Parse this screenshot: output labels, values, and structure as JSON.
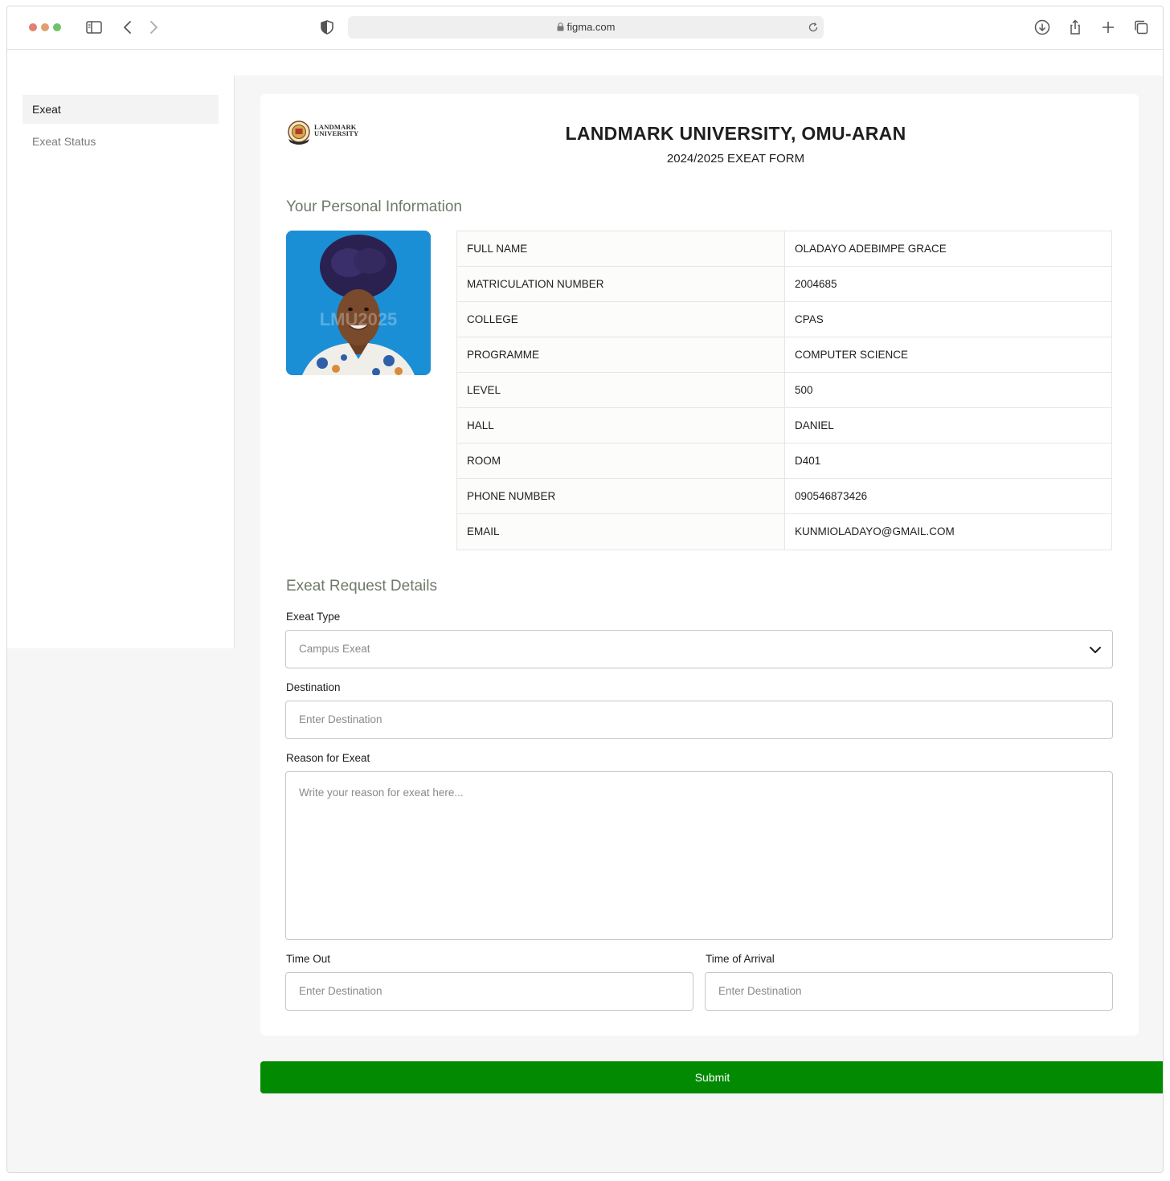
{
  "browser": {
    "url": "figma.com",
    "icons": [
      "sidebar-icon",
      "back-icon",
      "forward-icon",
      "shield-icon",
      "lock-icon",
      "reload-icon",
      "download-icon",
      "share-icon",
      "new-tab-icon",
      "tabs-icon"
    ]
  },
  "sidebar": {
    "items": [
      {
        "label": "Exeat",
        "active": true
      },
      {
        "label": "Exeat Status",
        "active": false
      }
    ]
  },
  "header": {
    "logo_line1": "LANDMARK",
    "logo_line2": "UNIVERSITY",
    "title": "LANDMARK UNIVERSITY, OMU-ARAN",
    "subtitle": "2024/2025 EXEAT FORM"
  },
  "personal": {
    "section_title": "Your Personal Information",
    "photo_watermark": "LMU2025",
    "rows": [
      {
        "key": "FULL NAME",
        "value": "OLADAYO ADEBIMPE GRACE"
      },
      {
        "key": "MATRICULATION NUMBER",
        "value": "2004685"
      },
      {
        "key": "COLLEGE",
        "value": "CPAS"
      },
      {
        "key": "PROGRAMME",
        "value": "COMPUTER SCIENCE"
      },
      {
        "key": "LEVEL",
        "value": "500"
      },
      {
        "key": "HALL",
        "value": "DANIEL"
      },
      {
        "key": "ROOM",
        "value": "D401"
      },
      {
        "key": "PHONE NUMBER",
        "value": "090546873426"
      },
      {
        "key": "EMAIL",
        "value": "KUNMIOLADAYO@GMAIL.COM"
      }
    ]
  },
  "request": {
    "section_title": "Exeat Request Details",
    "exeat_type_label": "Exeat Type",
    "exeat_type_value": "Campus Exeat",
    "destination_label": "Destination",
    "destination_placeholder": "Enter Destination",
    "reason_label": "Reason for Exeat",
    "reason_placeholder": "Write your reason for exeat here...",
    "time_out_label": "Time Out",
    "time_out_placeholder": "Enter Destination",
    "arrival_label": "Time of Arrival",
    "arrival_placeholder": "Enter Destination"
  },
  "submit_label": "Submit",
  "colors": {
    "accent": "#038a03",
    "section_title": "#6e7a6a",
    "photo_bg": "#1b8fd6"
  }
}
